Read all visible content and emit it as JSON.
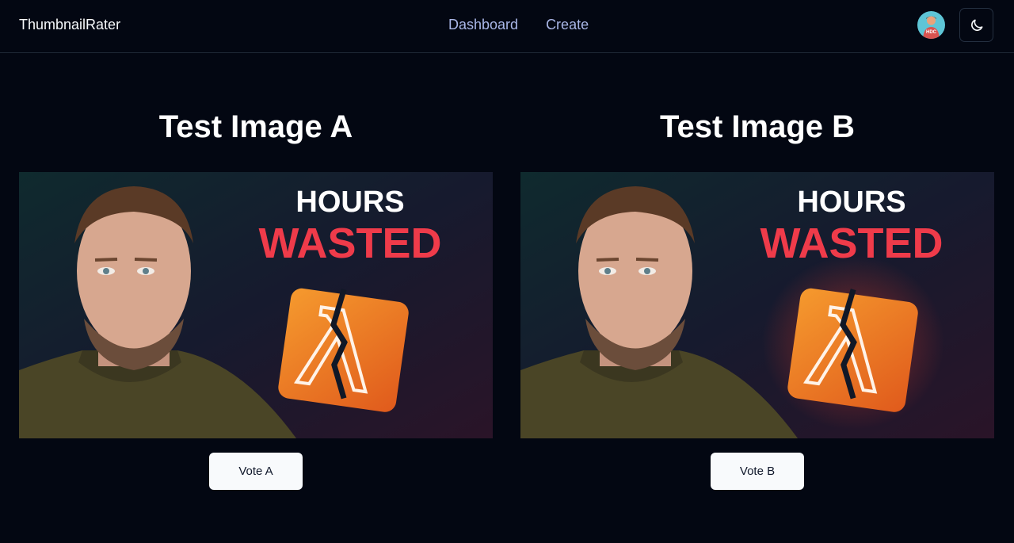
{
  "header": {
    "brand": "ThumbnailRater",
    "nav": [
      {
        "label": "Dashboard"
      },
      {
        "label": "Create"
      }
    ],
    "avatar_text": "HDC",
    "theme_icon": "moon-icon"
  },
  "tests": [
    {
      "title": "Test Image A",
      "thumb_line1": "HOURS",
      "thumb_line2": "WASTED",
      "vote_label": "Vote A",
      "logo_glow": false
    },
    {
      "title": "Test Image B",
      "thumb_line1": "HOURS",
      "thumb_line2": "WASTED",
      "vote_label": "Vote B",
      "logo_glow": true
    }
  ],
  "colors": {
    "background": "#030712",
    "nav_link": "#aab7e8",
    "wasted_red": "#ef3b4a",
    "logo_orange": "#f07a24"
  }
}
